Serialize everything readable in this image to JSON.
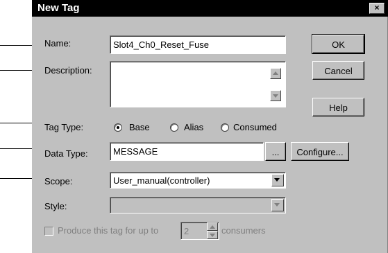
{
  "dialog": {
    "title": "New Tag",
    "close_glyph": "×"
  },
  "labels": {
    "name": "Name:",
    "description": "Description:",
    "tag_type": "Tag Type:",
    "data_type": "Data Type:",
    "scope": "Scope:",
    "style": "Style:"
  },
  "fields": {
    "name_value": "Slot4_Ch0_Reset_Fuse",
    "description_value": "",
    "data_type_value": "MESSAGE",
    "scope_value": "User_manual(controller)",
    "style_value": "",
    "consumers_value": "2"
  },
  "tag_type_options": [
    {
      "label": "Base",
      "selected": true
    },
    {
      "label": "Alias",
      "selected": false
    },
    {
      "label": "Consumed",
      "selected": false
    }
  ],
  "buttons": {
    "ok": "OK",
    "cancel": "Cancel",
    "help": "Help",
    "browse": "...",
    "configure": "Configure..."
  },
  "produce": {
    "label": "Produce this tag for up to",
    "suffix": "consumers",
    "checked": false
  },
  "icons": {
    "close": "close-icon",
    "dropdown": "chevron-down-icon",
    "scroll_up": "scroll-up-icon",
    "scroll_down": "scroll-down-icon"
  }
}
